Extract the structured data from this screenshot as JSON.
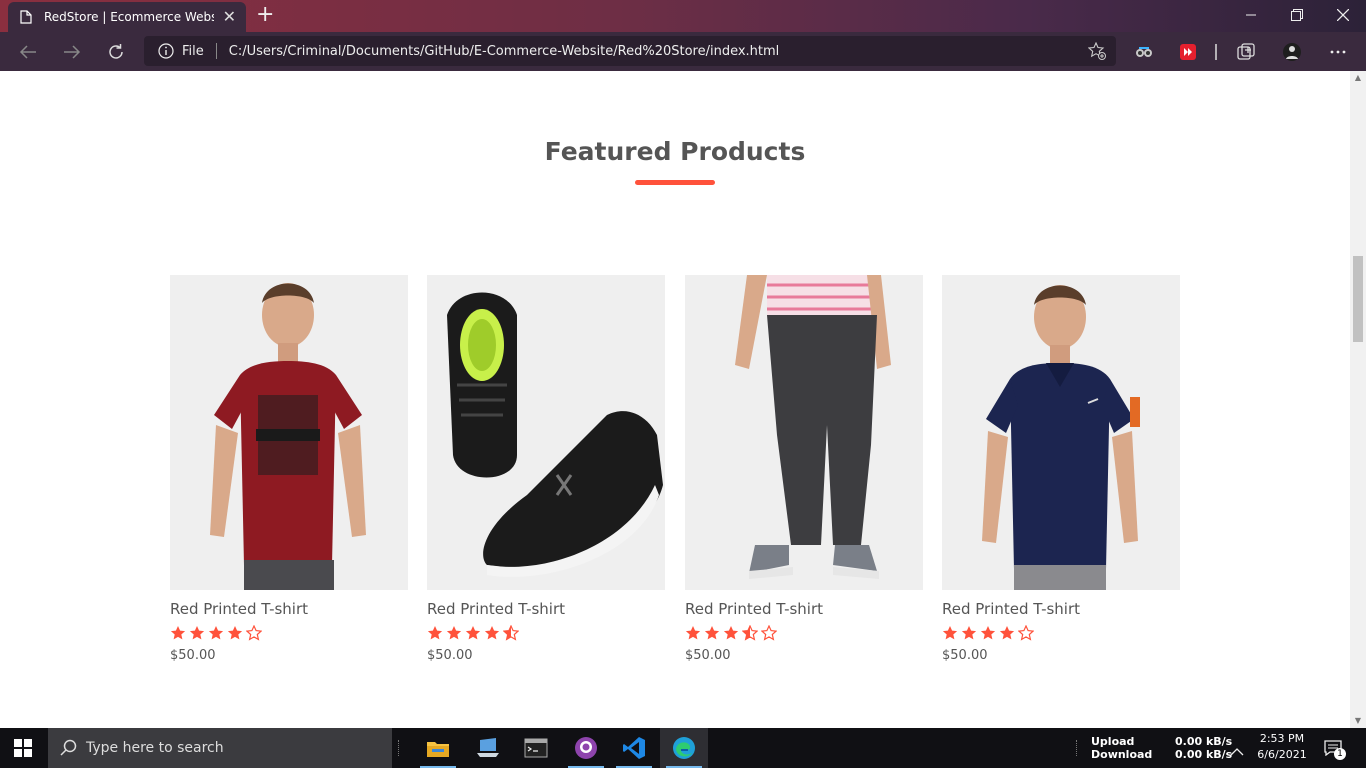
{
  "browser": {
    "tab_title": "RedStore | Ecommerce Website D",
    "new_tab_label": "+",
    "address_info_label": "File",
    "url": "C:/Users/Criminal/Documents/GitHub/E-Commerce-Website/Red%20Store/index.html",
    "window_controls": [
      "minimize",
      "restore",
      "close"
    ]
  },
  "page": {
    "section_title": "Featured Products",
    "accent_color": "#ff523b",
    "products": [
      {
        "name": "Red Printed T-shirt",
        "rating": 4,
        "price": "$50.00",
        "image": "red-tshirt-model"
      },
      {
        "name": "Red Printed T-shirt",
        "rating": 4.5,
        "price": "$50.00",
        "image": "black-shoes"
      },
      {
        "name": "Red Printed T-shirt",
        "rating": 3.5,
        "price": "$50.00",
        "image": "grey-joggers"
      },
      {
        "name": "Red Printed T-shirt",
        "rating": 4,
        "price": "$50.00",
        "image": "navy-polo-model"
      }
    ]
  },
  "taskbar": {
    "search_placeholder": "Type here to search",
    "net_upload_label": "Upload",
    "net_download_label": "Download",
    "net_upload_rate": "0.00 kB/s",
    "net_download_rate": "0.00 kB/s",
    "time": "2:53 PM",
    "date": "6/6/2021",
    "notification_count": "1"
  }
}
